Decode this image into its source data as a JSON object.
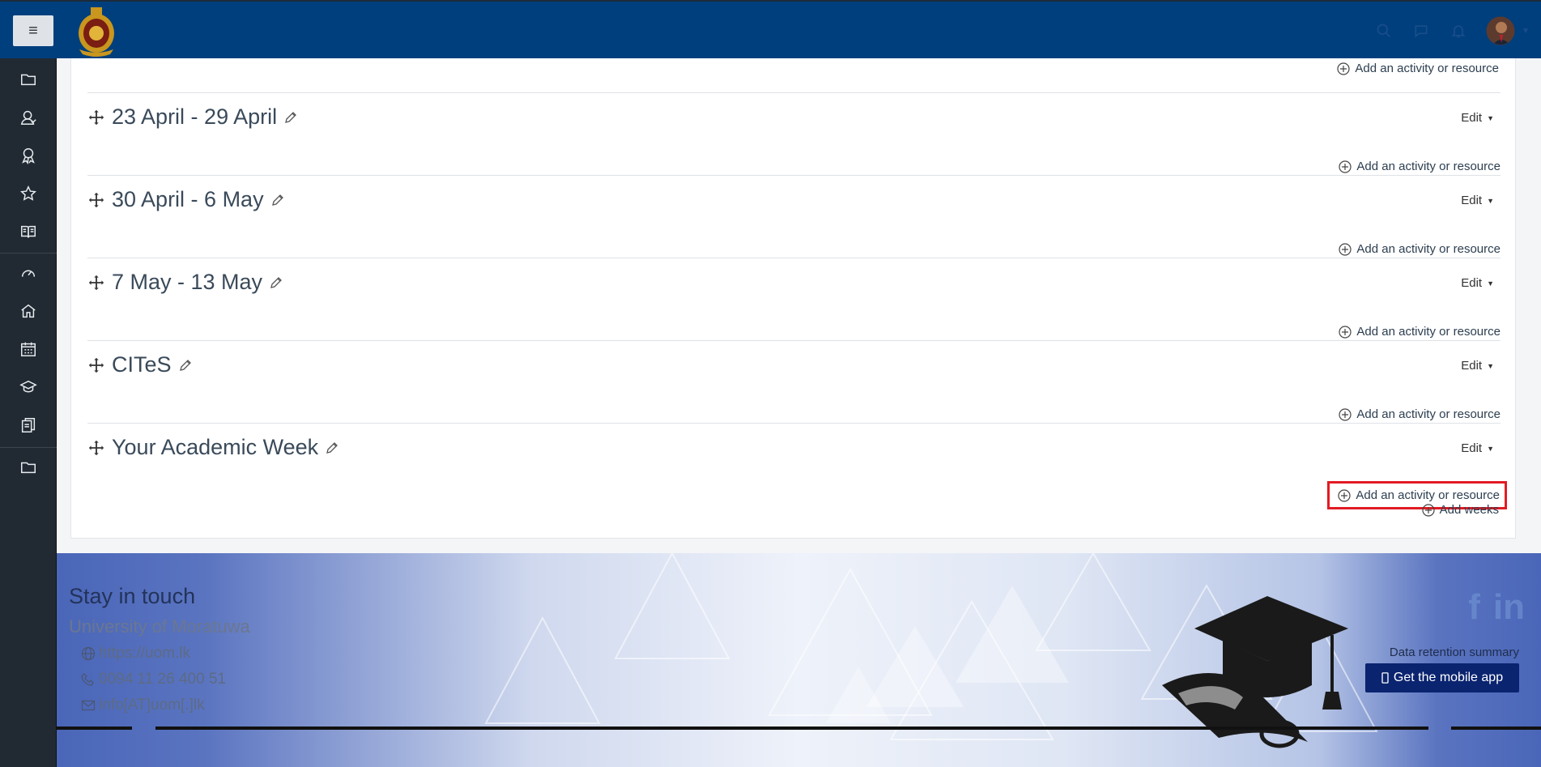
{
  "navbar": {
    "menu_icon": "hamburger-icon",
    "logo": "university-crest-logo",
    "search_icon": "search-icon",
    "messages_icon": "chat-bubble-icon",
    "notifications_icon": "bell-icon",
    "avatar": "user-avatar"
  },
  "sidebar": {
    "items": [
      {
        "icon": "folder-icon"
      },
      {
        "icon": "participants-icon"
      },
      {
        "icon": "badges-icon"
      },
      {
        "icon": "star-icon"
      },
      {
        "icon": "book-icon"
      },
      {
        "icon": "dashboard-icon"
      },
      {
        "icon": "home-icon"
      },
      {
        "icon": "calendar-icon"
      },
      {
        "icon": "graduation-cap-icon"
      },
      {
        "icon": "files-icon"
      },
      {
        "icon": "folder-icon"
      }
    ]
  },
  "course": {
    "top_add_label": "Add an activity or resource",
    "sections": [
      {
        "title": "23 April - 29 April",
        "edit_label": "Edit",
        "add_label": "Add an activity or resource"
      },
      {
        "title": "30 April - 6 May",
        "edit_label": "Edit",
        "add_label": "Add an activity or resource"
      },
      {
        "title": "7 May - 13 May",
        "edit_label": "Edit",
        "add_label": "Add an activity or resource"
      },
      {
        "title": "CITeS",
        "edit_label": "Edit",
        "add_label": "Add an activity or resource"
      },
      {
        "title": "Your Academic Week",
        "edit_label": "Edit",
        "add_label": "Add an activity or resource"
      }
    ],
    "add_weeks_label": "Add weeks"
  },
  "footer": {
    "heading": "Stay in touch",
    "org": "University of Moratuwa",
    "website": "https://uom.lk",
    "phone": "0094 11 26 400 51",
    "email": "info[AT]uom[.]lk",
    "social": [
      "facebook-icon",
      "linkedin-icon"
    ],
    "retention": "Data retention summary",
    "mobile_app": "Get the mobile app"
  },
  "colors": {
    "navbar": "#003f7d",
    "sidebar": "#212a33",
    "highlight": "#e21b23",
    "mobile_button": "#0b2470"
  }
}
